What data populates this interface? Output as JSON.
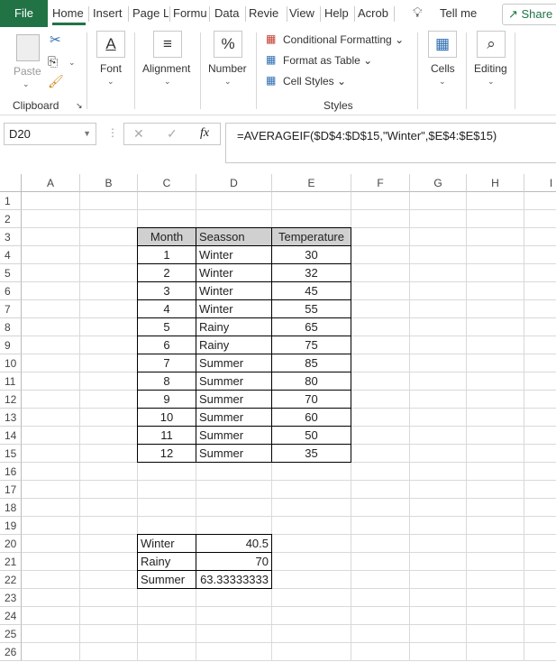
{
  "tabs": [
    "File",
    "Home",
    "Insert",
    "Page L",
    "Formu",
    "Data",
    "Revie",
    "View",
    "Help",
    "Acrob"
  ],
  "tell_me": "Tell me",
  "share": "Share",
  "ribbon": {
    "clipboard": {
      "paste": "Paste",
      "label": "Clipboard"
    },
    "font": "Font",
    "alignment": "Alignment",
    "number": "Number",
    "styles": {
      "conditional": "Conditional Formatting",
      "format_table": "Format as Table",
      "cell_styles": "Cell Styles",
      "label": "Styles"
    },
    "cells": "Cells",
    "editing": "Editing"
  },
  "formula_bar": {
    "name_box": "D20",
    "formula": "=AVERAGEIF($D$4:$D$15,\"Winter\",$E$4:$E$15)"
  },
  "columns": [
    "A",
    "B",
    "C",
    "D",
    "E",
    "F",
    "G",
    "H",
    "I"
  ],
  "rows": 26,
  "table": {
    "headers": [
      "Month",
      "Seasson",
      "Temperature"
    ],
    "rows": [
      [
        "1",
        "Winter",
        "30"
      ],
      [
        "2",
        "Winter",
        "32"
      ],
      [
        "3",
        "Winter",
        "45"
      ],
      [
        "4",
        "Winter",
        "55"
      ],
      [
        "5",
        "Rainy",
        "65"
      ],
      [
        "6",
        "Rainy",
        "75"
      ],
      [
        "7",
        "Summer",
        "85"
      ],
      [
        "8",
        "Summer",
        "80"
      ],
      [
        "9",
        "Summer",
        "70"
      ],
      [
        "10",
        "Summer",
        "60"
      ],
      [
        "11",
        "Summer",
        "50"
      ],
      [
        "12",
        "Summer",
        "35"
      ]
    ]
  },
  "summary": [
    [
      "Winter",
      "40.5"
    ],
    [
      "Rainy",
      "70"
    ],
    [
      "Summer",
      "63.33333333"
    ]
  ],
  "colors": {
    "accent": "#217346",
    "header_fill": "#d0d0d0"
  }
}
